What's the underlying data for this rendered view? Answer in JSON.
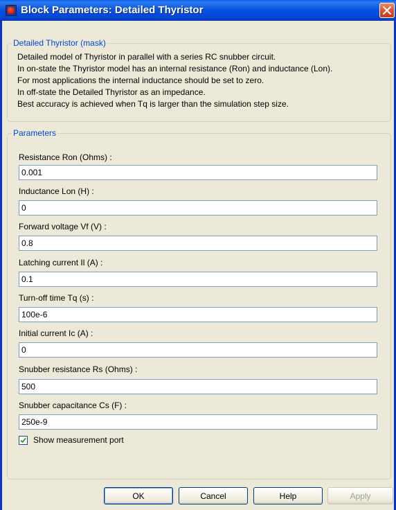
{
  "window": {
    "title": "Block Parameters: Detailed Thyristor"
  },
  "mask_group": {
    "legend": "Detailed Thyristor (mask)",
    "description": [
      "Detailed model of Thyristor in parallel with a series RC snubber circuit.",
      "In on-state the Thyristor model  has an internal resistance (Ron) and inductance (Lon).",
      "For most applications the internal inductance should be set to zero.",
      "In off-state the Detailed Thyristor  as an impedance.",
      "Best accuracy is achieved when Tq is larger than the simulation step size."
    ]
  },
  "params_group": {
    "legend": "Parameters",
    "fields": [
      {
        "label": "Resistance Ron (Ohms) :",
        "value": "0.001"
      },
      {
        "label": "Inductance Lon (H) :",
        "value": "0"
      },
      {
        "label": "Forward voltage Vf (V) :",
        "value": "0.8"
      },
      {
        "label": "Latching current Il (A) :",
        "value": "0.1"
      },
      {
        "label": "Turn-off time Tq (s) :",
        "value": "100e-6"
      },
      {
        "label": "Initial current Ic (A) :",
        "value": "0"
      },
      {
        "label": "Snubber resistance Rs (Ohms) :",
        "value": "500"
      },
      {
        "label": "Snubber capacitance Cs (F) :",
        "value": "250e-9"
      }
    ],
    "show_measurement": {
      "label": "Show measurement port",
      "checked": true
    }
  },
  "buttons": {
    "ok": "OK",
    "cancel": "Cancel",
    "help": "Help",
    "apply": "Apply"
  },
  "colors": {
    "titlebar": "#0a54e0",
    "legend": "#0046d5",
    "dialog_bg": "#ece9d8",
    "close": "#e0502a"
  },
  "icons": {
    "app": "simulink-block-icon",
    "close": "close-icon",
    "check": "checkmark-icon"
  }
}
